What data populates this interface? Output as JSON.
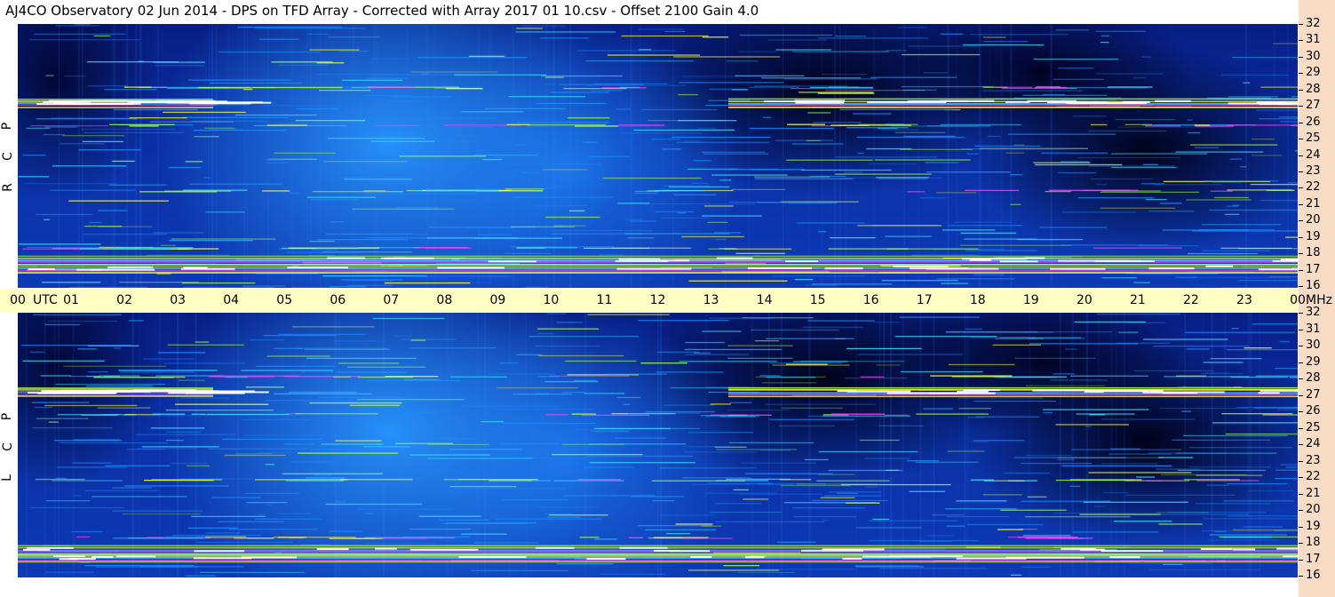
{
  "title": "AJ4CO Observatory  02 Jun 2014  -  DPS on TFD Array  -  Corrected with Array 2017 01 10.csv  -  Offset 2100  Gain 4.0",
  "chart_data": [
    {
      "type": "heatmap",
      "panel": "RCP",
      "ylabel": "R C P",
      "x_label_unit": "UTC",
      "y_unit": "MHz",
      "x_ticks": [
        "00",
        "01",
        "02",
        "03",
        "04",
        "05",
        "06",
        "07",
        "08",
        "09",
        "10",
        "11",
        "12",
        "13",
        "14",
        "15",
        "16",
        "17",
        "18",
        "19",
        "20",
        "21",
        "22",
        "23",
        "00"
      ],
      "y_ticks": [
        32,
        31,
        30,
        29,
        28,
        27,
        26,
        25,
        24,
        23,
        22,
        21,
        20,
        19,
        18,
        17,
        16
      ],
      "ylim": [
        16,
        32
      ],
      "colormap": [
        "#000000",
        "#08207f",
        "#0b3fd0",
        "#1a8cff",
        "#38d8ff",
        "#a8ff40",
        "#ffff30",
        "#ff40ff",
        "#ffffff"
      ],
      "bright_bands_mhz": [
        27.2,
        17.6,
        17.1
      ]
    },
    {
      "type": "heatmap",
      "panel": "LCP",
      "ylabel": "L C P",
      "x_label_unit": "UTC",
      "y_unit": "MHz",
      "x_ticks": [
        "00",
        "01",
        "02",
        "03",
        "04",
        "05",
        "06",
        "07",
        "08",
        "09",
        "10",
        "11",
        "12",
        "13",
        "14",
        "15",
        "16",
        "17",
        "18",
        "19",
        "20",
        "21",
        "22",
        "23",
        "00"
      ],
      "y_ticks": [
        32,
        31,
        30,
        29,
        28,
        27,
        26,
        25,
        24,
        23,
        22,
        21,
        20,
        19,
        18,
        17,
        16
      ],
      "ylim": [
        16,
        32
      ],
      "colormap": [
        "#000000",
        "#08207f",
        "#0b3fd0",
        "#1a8cff",
        "#38d8ff",
        "#a8ff40",
        "#ffff30",
        "#ff40ff",
        "#ffffff"
      ],
      "bright_bands_mhz": [
        27.2,
        17.6,
        17.1
      ]
    }
  ],
  "axis": {
    "utc_word": "UTC",
    "mhz_word": "MHz",
    "rcp_letters": [
      "R",
      "C",
      "P"
    ],
    "lcp_letters": [
      "L",
      "C",
      "P"
    ]
  },
  "colors": {
    "side_strip": "#f8dcc6",
    "time_bar": "#ffffc4"
  }
}
